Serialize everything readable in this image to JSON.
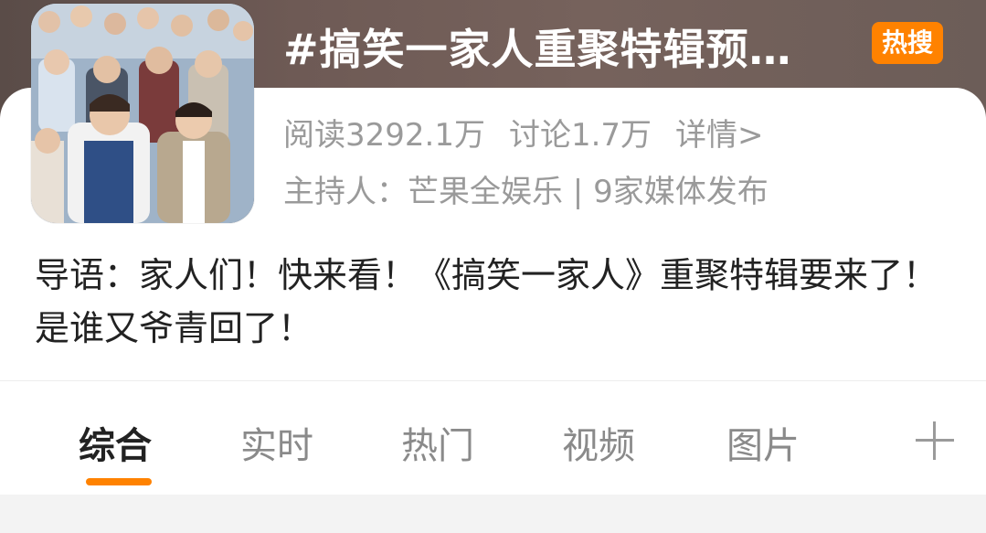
{
  "topic": {
    "title": "#搞笑一家人重聚特辑预…",
    "badge": "热搜",
    "reads": "阅读3292.1万",
    "discussions": "讨论1.7万",
    "details_link": "详情>",
    "host_line": "主持人：芒果全娱乐 | 9家媒体发布",
    "intro": "导语：家人们！快来看！《搞笑一家人》重聚特辑要来了！是谁又爷青回了！"
  },
  "tabs": [
    {
      "label": "综合",
      "active": true
    },
    {
      "label": "实时",
      "active": false
    },
    {
      "label": "热门",
      "active": false
    },
    {
      "label": "视频",
      "active": false
    },
    {
      "label": "图片",
      "active": false
    }
  ],
  "colors": {
    "accent": "#ff8200",
    "muted_text": "#9a9a9a",
    "body_text": "#222222"
  },
  "icons": {
    "add_tab": "plus-icon"
  }
}
